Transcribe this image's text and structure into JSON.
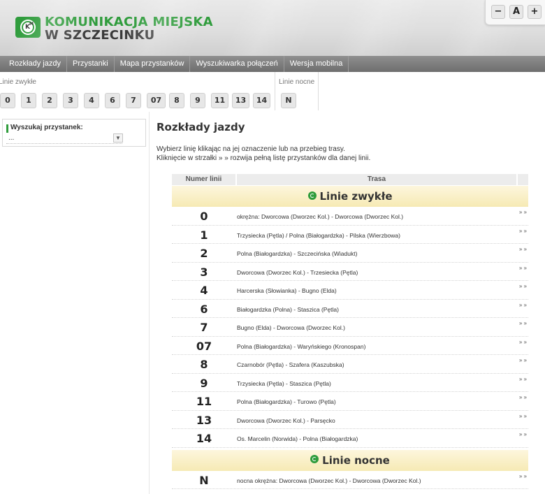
{
  "header": {
    "logo_line1": "KOMUNIKACJA MIEJSKA",
    "logo_line2": "W SZCZECINKU",
    "font_controls": [
      "−",
      "A",
      "+"
    ]
  },
  "nav": [
    "Rozkłady jazdy",
    "Przystanki",
    "Mapa przystanków",
    "Wyszukiwarka połączeń",
    "Wersja mobilna"
  ],
  "picker": {
    "regular_label": "Linie zwykłe",
    "regular_lines": [
      "0",
      "1",
      "2",
      "3",
      "4",
      "6",
      "7",
      "07",
      "8",
      "9",
      "11",
      "13",
      "14"
    ],
    "night_label": "Linie nocne",
    "night_lines": [
      "N"
    ]
  },
  "sidebar": {
    "search_label": "Wyszukaj przystanek:",
    "selected": "..."
  },
  "main": {
    "title": "Rozkłady jazdy",
    "desc1": "Wybierz linię klikając na jej oznaczenie lub na przebieg trasy.",
    "desc2": "Kliknięcie w strzałki » » rozwija pełną listę przystanków dla danej linii.",
    "col_line": "Numer linii",
    "col_route": "Trasa",
    "expand": "» »",
    "sections": [
      {
        "label": "Linie zwykłe",
        "rows": [
          {
            "num": "0",
            "route": "okrężna: Dworcowa (Dworzec Kol.) - Dworcowa (Dworzec Kol.)"
          },
          {
            "num": "1",
            "route": "Trzysiecka (Pętla) / Polna (Białogardzka) - Pilska (Wierzbowa)"
          },
          {
            "num": "2",
            "route": "Polna (Białogardzka) - Szczecińska (Wiadukt)"
          },
          {
            "num": "3",
            "route": "Dworcowa (Dworzec Kol.) - Trzesiecka (Pętla)"
          },
          {
            "num": "4",
            "route": "Harcerska (Słowianka) - Bugno (Elda)"
          },
          {
            "num": "6",
            "route": "Białogardzka (Polna) - Staszica (Pętla)"
          },
          {
            "num": "7",
            "route": "Bugno (Elda) - Dworcowa (Dworzec Kol.)"
          },
          {
            "num": "07",
            "route": "Polna (Białogardzka) - Waryńskiego (Kronospan)"
          },
          {
            "num": "8",
            "route": "Czarnobór (Pętla) - Szafera (Kaszubska)"
          },
          {
            "num": "9",
            "route": "Trzysiecka (Pętla) - Staszica (Pętla)"
          },
          {
            "num": "11",
            "route": "Polna (Białogardzka) - Turowo (Pętla)"
          },
          {
            "num": "13",
            "route": "Dworcowa (Dworzec Kol.) - Parsęcko"
          },
          {
            "num": "14",
            "route": "Os. Marcelin (Norwida) - Polna (Białogardzka)"
          }
        ]
      },
      {
        "label": "Linie nocne",
        "rows": [
          {
            "num": "N",
            "route": "nocna okrężna: Dworcowa (Dworzec Kol.) - Dworcowa (Dworzec Kol.)"
          }
        ]
      }
    ]
  }
}
